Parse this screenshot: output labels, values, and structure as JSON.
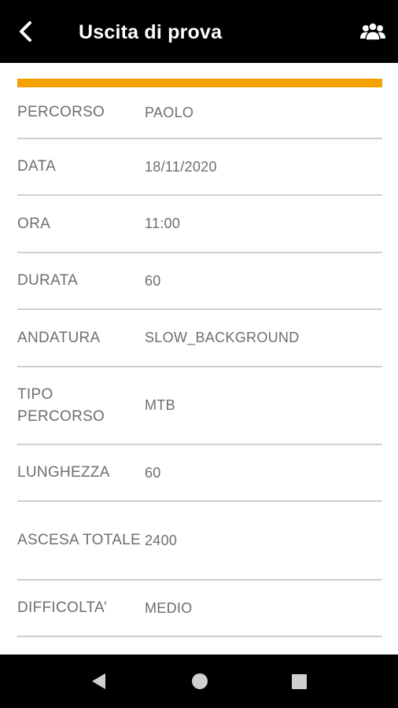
{
  "header": {
    "title": "Uscita di prova",
    "back_icon": "back-arrow-icon",
    "group_icon": "group-people-icon"
  },
  "colors": {
    "appbar": "#000000",
    "accent": "#f5a100",
    "label_text": "#6e6e6e",
    "divider": "#cfcfcf"
  },
  "details": {
    "rows": [
      {
        "label": "PERCORSO",
        "value": "PAOLO"
      },
      {
        "label": "DATA",
        "value": "18/11/2020"
      },
      {
        "label": "ORA",
        "value": "11:00"
      },
      {
        "label": "DURATA",
        "value": "60"
      },
      {
        "label": "ANDATURA",
        "value": "SLOW_BACKGROUND"
      },
      {
        "label": "TIPO PERCORSO",
        "value": "MTB"
      },
      {
        "label": "LUNGHEZZA",
        "value": "60"
      },
      {
        "label": "ASCESA TOTALE",
        "value": "2400"
      },
      {
        "label": "DIFFICOLTA’",
        "value": "MEDIO"
      }
    ]
  },
  "navbar": {
    "back": "nav-back-triangle-icon",
    "home": "nav-home-circle-icon",
    "recents": "nav-recents-square-icon"
  }
}
